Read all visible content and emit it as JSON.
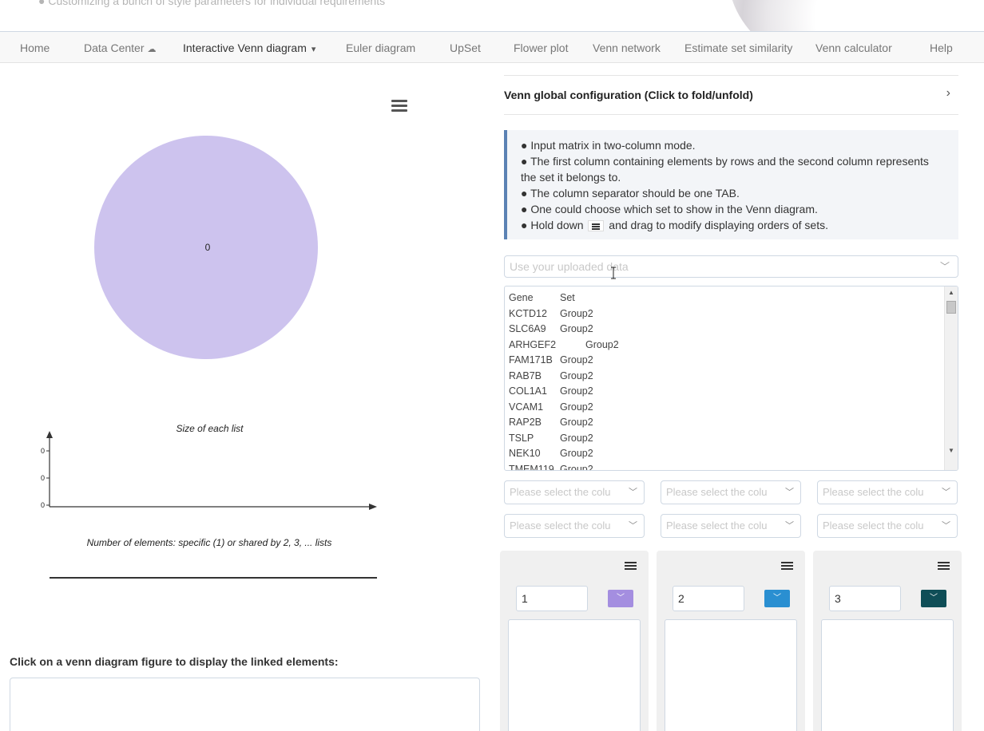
{
  "header": {
    "tagline": "● Customizing a bunch of style parameters for individual requirements"
  },
  "nav": {
    "items": [
      {
        "label": "Home"
      },
      {
        "label": "Data Center"
      },
      {
        "label": "Interactive Venn diagram"
      },
      {
        "label": "Euler diagram"
      },
      {
        "label": "UpSet"
      },
      {
        "label": "Flower plot"
      },
      {
        "label": "Venn network"
      },
      {
        "label": "Estimate set similarity"
      },
      {
        "label": "Venn calculator"
      },
      {
        "label": "Help"
      }
    ],
    "active_index": 2
  },
  "venn": {
    "circle_color": "#cdc3ee",
    "center_label": "0"
  },
  "chart_data": {
    "type": "bar",
    "title": "Size of each list",
    "xlabel": "Number of elements: specific (1) or shared by 2, 3, ... lists",
    "ytick_labels": [
      "0",
      "0",
      "0"
    ],
    "categories": [],
    "values": []
  },
  "linked": {
    "title": "Click on a venn diagram figure to display the linked elements:"
  },
  "config": {
    "title": "Venn global configuration (Click to fold/unfold)",
    "info_lines": [
      "● Input matrix in two-column mode.",
      "● The first column containing elements by rows and the second column represents the set it belongs to.",
      "● The column separator should be one TAB.",
      "● One could choose which set to show in the Venn diagram."
    ],
    "info_last_prefix": "● Hold down",
    "info_last_suffix": "and drag to modify displaying orders of sets.",
    "data_select_placeholder": "Use your uploaded data",
    "data_header": {
      "gene": "Gene",
      "set": "Set"
    },
    "rows": [
      {
        "gene": "KCTD12",
        "set": "Group2"
      },
      {
        "gene": "SLC6A9",
        "set": "Group2"
      },
      {
        "gene": "ARHGEF2",
        "set": "Group2"
      },
      {
        "gene": "FAM171B",
        "set": "Group2"
      },
      {
        "gene": "RAB7B",
        "set": "Group2"
      },
      {
        "gene": "COL1A1",
        "set": "Group2"
      },
      {
        "gene": "VCAM1",
        "set": "Group2"
      },
      {
        "gene": "RAP2B",
        "set": "Group2"
      },
      {
        "gene": "TSLP",
        "set": "Group2"
      },
      {
        "gene": "NEK10",
        "set": "Group2"
      },
      {
        "gene": "TMEM119",
        "set": "Group2"
      }
    ],
    "column_select_placeholder": "Please select the colu"
  },
  "sets": [
    {
      "name": "1",
      "color": "#a48ee0"
    },
    {
      "name": "2",
      "color": "#2a8fd1"
    },
    {
      "name": "3",
      "color": "#0f4e57"
    }
  ]
}
